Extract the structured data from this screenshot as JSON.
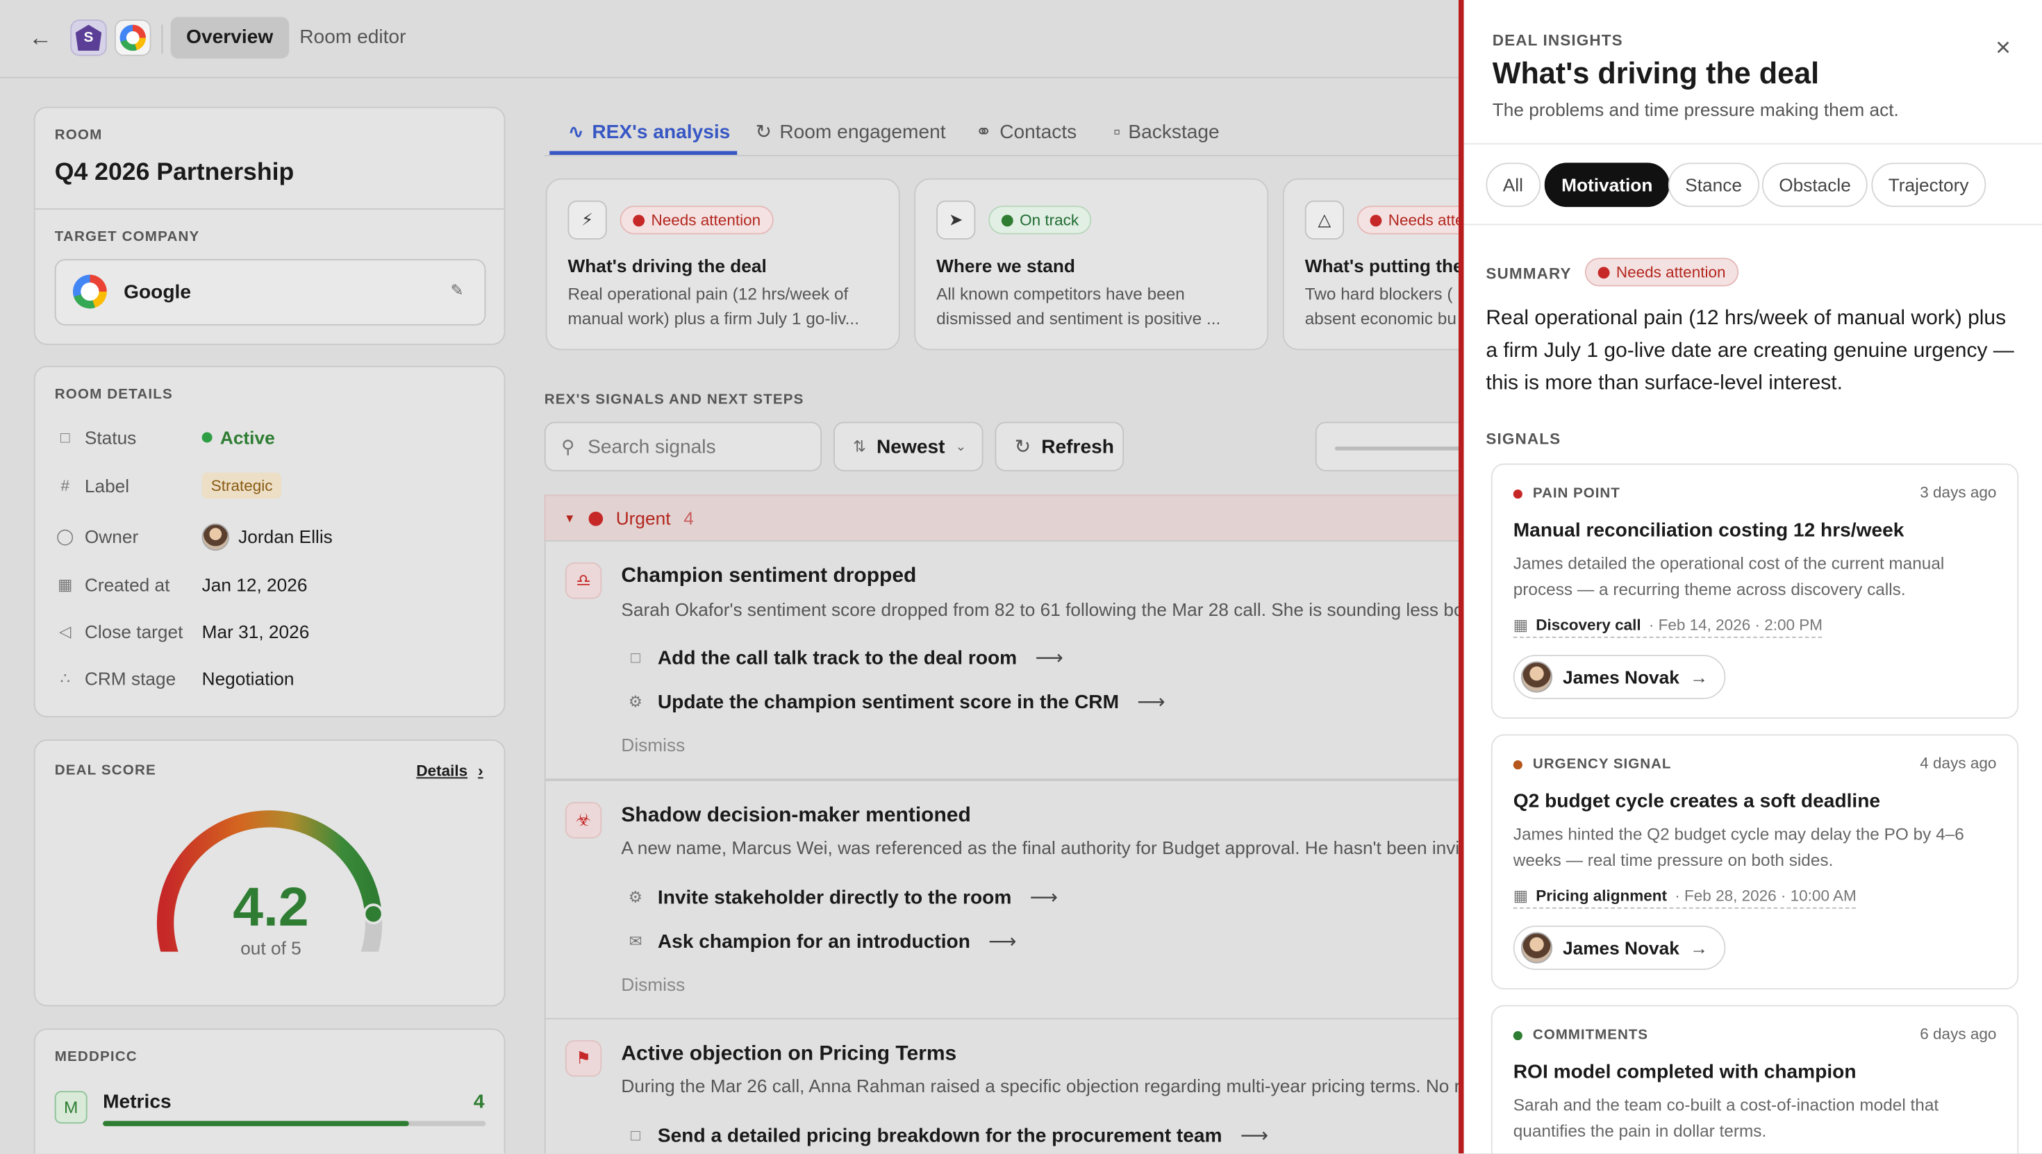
{
  "topbar": {
    "tabs": [
      "Overview",
      "Room editor"
    ],
    "brand_letter": "S"
  },
  "room": {
    "label": "ROOM",
    "name": "Q4 2026 Partnership",
    "target_label": "TARGET COMPANY",
    "company": "Google"
  },
  "room_details": {
    "label": "ROOM DETAILS",
    "rows": [
      {
        "key": "Status",
        "value": "Active"
      },
      {
        "key": "Label",
        "value": "Strategic"
      },
      {
        "key": "Owner",
        "value": "Jordan Ellis"
      },
      {
        "key": "Created at",
        "value": "Jan 12, 2026"
      },
      {
        "key": "Close target",
        "value": "Mar 31, 2026"
      },
      {
        "key": "CRM stage",
        "value": "Negotiation"
      }
    ]
  },
  "deal_score": {
    "label": "DEAL SCORE",
    "details": "Details",
    "value": "4.2",
    "of": "out of 5",
    "score": 4.2,
    "max": 5
  },
  "meddpicc": {
    "label": "MEDDPICC",
    "item_letter": "M",
    "item": "Metrics",
    "score": "4",
    "fill_fraction": 0.8
  },
  "mid_tabs": [
    "REX's analysis",
    "Room engagement",
    "Contacts",
    "Backstage"
  ],
  "insight_cards": [
    {
      "badge": "Needs attention",
      "title": "What's driving the deal",
      "line1": "Real operational pain (12 hrs/week of",
      "line2": "manual work) plus a firm July 1 go-liv..."
    },
    {
      "badge": "On track",
      "title": "Where we stand",
      "line1": "All known competitors have been",
      "line2": "dismissed and sentiment is positive ..."
    },
    {
      "badge": "Needs atte",
      "title": "What's putting the",
      "line1": "Two hard blockers (",
      "line2": "absent economic bu"
    }
  ],
  "signals_section": {
    "label": "REX'S SIGNALS AND NEXT STEPS",
    "search_placeholder": "Search signals",
    "sort": "Newest",
    "refresh": "Refresh",
    "group_label": "Urgent",
    "group_count": "4"
  },
  "signal_items": [
    {
      "title": "Champion sentiment dropped",
      "desc": "Sarah Okafor's sentiment score dropped from 82 to 61 following the Mar 28 call. She is sounding less boug",
      "actions": [
        "Add the call talk track to the deal room",
        "Update the champion sentiment score in the CRM"
      ],
      "dismiss": "Dismiss"
    },
    {
      "title": "Shadow decision-maker mentioned",
      "desc": "A new name, Marcus Wei, was referenced as the final authority for Budget approval. He hasn't been invited",
      "actions": [
        "Invite stakeholder directly to the room",
        "Ask champion for an introduction"
      ],
      "dismiss": "Dismiss"
    },
    {
      "title": "Active objection on Pricing Terms",
      "desc": "During the Mar 26 call, Anna Rahman raised a specific objection regarding multi-year pricing terms. No res",
      "actions": [
        "Send a detailed pricing breakdown for the procurement team"
      ]
    }
  ],
  "panel": {
    "eyebrow": "DEAL INSIGHTS",
    "title": "What's driving the deal",
    "subtitle": "The problems and time pressure making them act.",
    "chips": [
      "All",
      "Motivation",
      "Stance",
      "Obstacle",
      "Trajectory"
    ],
    "summary_label": "SUMMARY",
    "summary_badge": "Needs attention",
    "summary_lines": [
      "Real operational pain (12 hrs/week of manual work) plus",
      "a firm July 1 go-live date are creating genuine urgency —",
      "this is more than surface-level interest."
    ],
    "signals_label": "SIGNALS",
    "signals": [
      {
        "category": "PAIN POINT",
        "color": "#c62828",
        "ago": "3 days ago",
        "title": "Manual reconciliation costing 12 hrs/week",
        "desc": "James detailed the operational cost of the current manual process — a recurring theme across discovery calls.",
        "source": "Discovery call",
        "date": "· Feb 14, 2026 · 2:00 PM",
        "person": "James Novak"
      },
      {
        "category": "URGENCY SIGNAL",
        "color": "#b5561d",
        "ago": "4 days ago",
        "title": "Q2 budget cycle creates a soft deadline",
        "desc": "James hinted the Q2 budget cycle may delay the PO by 4–6 weeks — real time pressure on both sides.",
        "source": "Pricing alignment",
        "date": "· Feb 28, 2026 · 10:00 AM",
        "person": "James Novak"
      },
      {
        "category": "COMMITMENTS",
        "color": "#2e7d32",
        "ago": "6 days ago",
        "title": "ROI model completed with champion",
        "desc": "Sarah and the team co-built a cost-of-inaction model that quantifies the pain in dollar terms."
      }
    ]
  }
}
